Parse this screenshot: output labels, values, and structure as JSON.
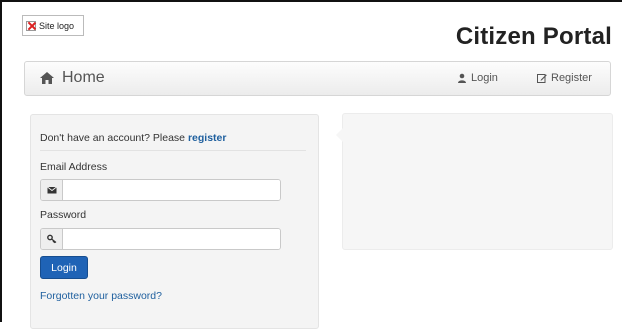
{
  "header": {
    "logo_alt": "Site logo",
    "portal_title": "Citizen Portal"
  },
  "navbar": {
    "home_label": "Home",
    "login_label": "Login",
    "register_label": "Register"
  },
  "login_panel": {
    "prompt_text": "Don't have an account? Please ",
    "prompt_link": "register",
    "email_label": "Email Address",
    "email_value": "",
    "password_label": "Password",
    "password_value": "",
    "login_button": "Login",
    "forgot_link": "Forgotten your password?"
  },
  "colors": {
    "primary_button": "#1f63b6",
    "link": "#1e5f9e"
  },
  "icons": {
    "logo": "broken-image-icon",
    "home": "home-icon",
    "login": "user-icon",
    "register": "edit-icon",
    "email": "envelope-icon",
    "password": "key-icon"
  }
}
